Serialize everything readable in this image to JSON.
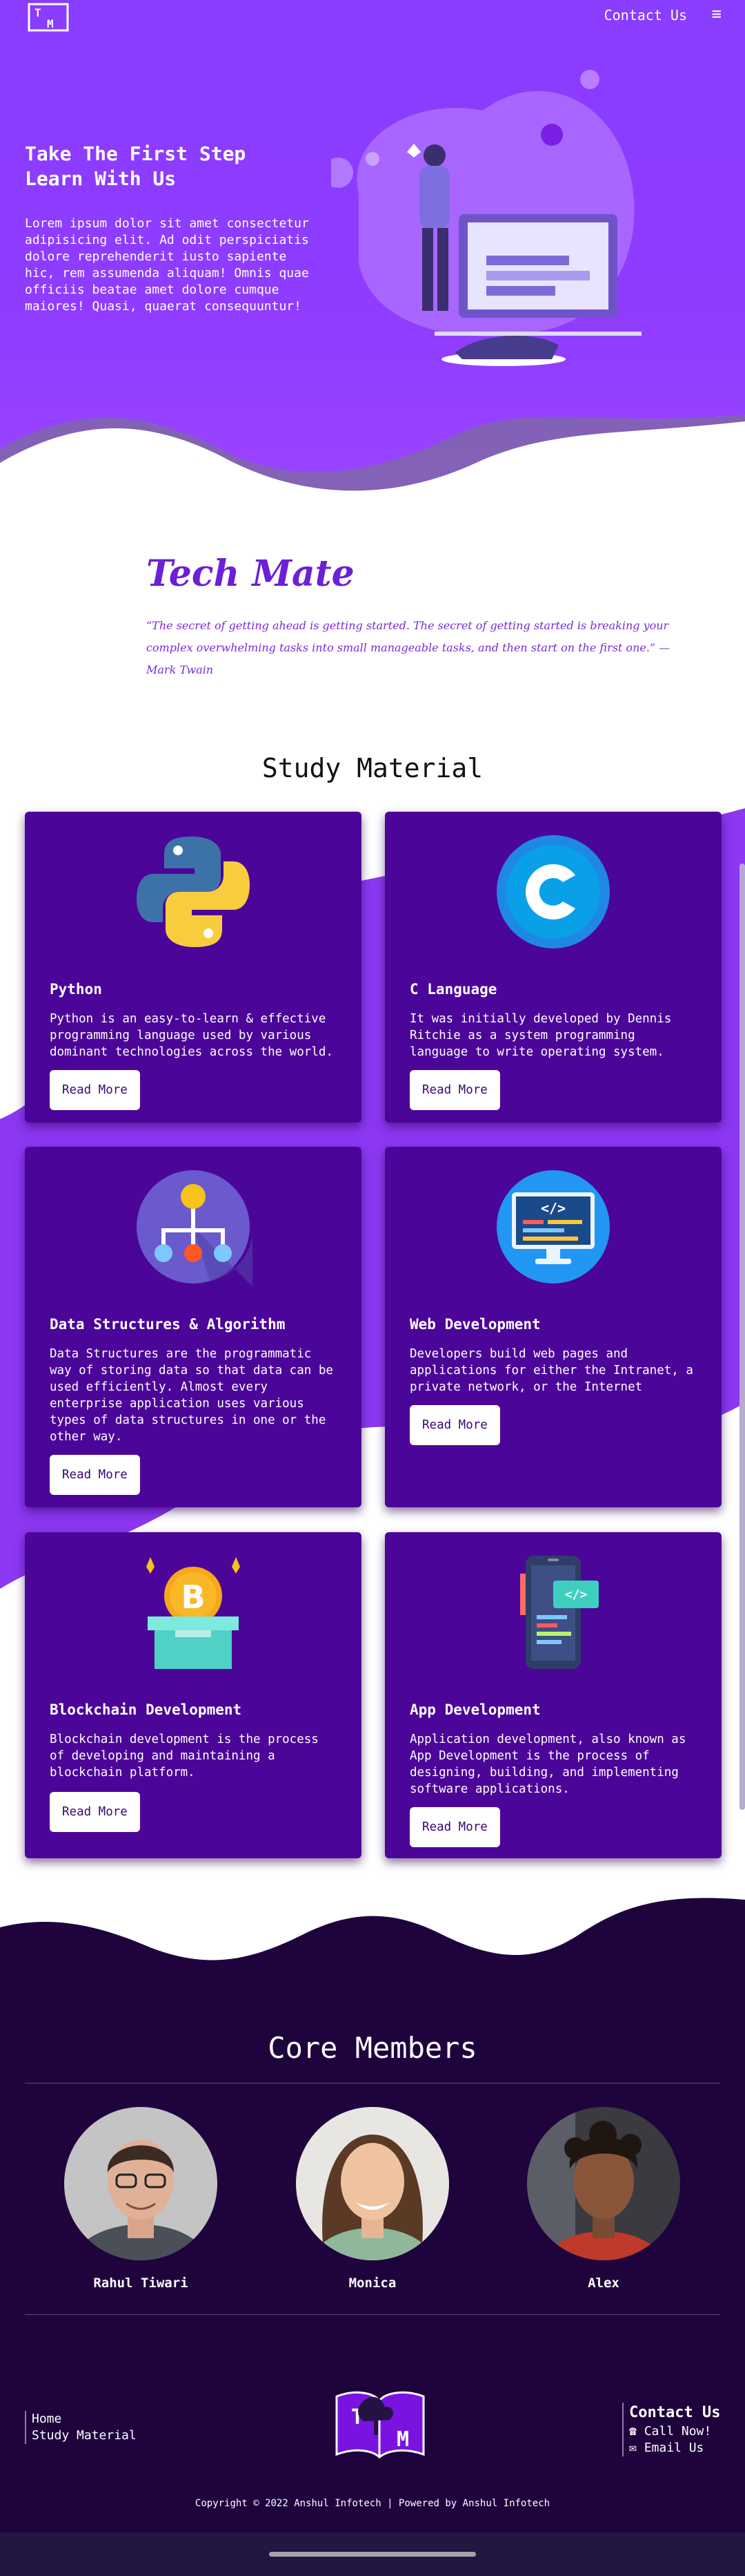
{
  "header": {
    "logo_label": "TM",
    "contact_label": "Contact Us",
    "menu_icon": "≡"
  },
  "hero": {
    "title": "Take The First Step Learn With Us",
    "text": "Lorem ipsum dolor sit amet consectetur adipisicing elit. Ad odit perspiciatis dolore reprehenderit iusto sapiente hic, rem assumenda aliquam! Omnis quae officiis beatae amet dolore cumque maiores! Quasi, quaerat consequuntur!"
  },
  "intro": {
    "brand": "Tech Mate",
    "quote": "“The secret of getting ahead is getting started. The secret of getting started is breaking your complex overwhelming tasks into small manageable tasks, and then start on the first one.” — Mark Twain"
  },
  "study": {
    "title": "Study Material",
    "cards": [
      {
        "title": "Python",
        "text": "Python is an easy-to-learn & effective programming language used by various dominant technologies across the world.",
        "button": "Read More",
        "icon": "python-logo-icon"
      },
      {
        "title": "C Language",
        "text": "It was initially developed by Dennis Ritchie as a system programming language to write operating system.",
        "button": "Read More",
        "icon": "c-language-icon"
      },
      {
        "title": "Data Structures & Algorithm",
        "text": "Data Structures are the programmatic way of storing data so that data can be used efficiently. Almost every enterprise application uses various types of data structures in one or the other way.",
        "button": "Read More",
        "icon": "hierarchy-tree-icon"
      },
      {
        "title": "Web Development",
        "text": "Developers build web pages and applications for either the Intranet, a private network, or the Internet",
        "button": "Read More",
        "icon": "code-monitor-icon"
      },
      {
        "title": "Blockchain Development",
        "text": "Blockchain development is the process of developing and maintaining a blockchain platform.",
        "button": "Read More",
        "icon": "bitcoin-box-icon"
      },
      {
        "title": "App Development",
        "text": "Application development, also known as App Development is the process of designing, building, and implementing software applications.",
        "button": "Read More",
        "icon": "mobile-code-icon"
      }
    ]
  },
  "members": {
    "title": "Core Members",
    "list": [
      {
        "name": "Rahul Tiwari"
      },
      {
        "name": "Monica"
      },
      {
        "name": "Alex"
      }
    ]
  },
  "footer": {
    "links": [
      "Home",
      "Study Material"
    ],
    "contact_title": "Contact Us",
    "call_label": "Call Now!",
    "email_label": "Email Us",
    "copyright": "Copyright © 2022 Anshul Infotech | Powered by Anshul Infotech"
  },
  "colors": {
    "hero_purple": "#8f3cff",
    "card_purple": "#4c0599",
    "footer_navy": "#1e033d",
    "brand_violet": "#6b1fd6"
  }
}
